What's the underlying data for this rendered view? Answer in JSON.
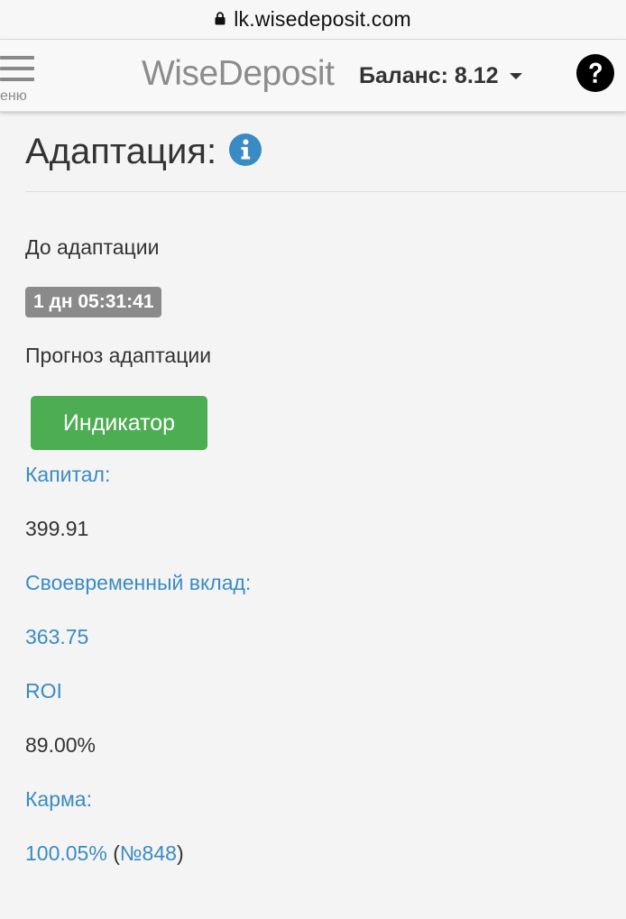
{
  "browser": {
    "url": "lk.wisedeposit.com"
  },
  "header": {
    "menu_label": "еню",
    "brand": "WiseDeposit",
    "balance_label": "Баланс: 8.12"
  },
  "main": {
    "title": "Адаптация:",
    "before_label": "До адаптации",
    "timer": "1 дн 05:31:41",
    "forecast_label": "Прогноз адаптации",
    "indicator_button": "Индикатор",
    "capital_label": "Капитал:",
    "capital_value": "399.91",
    "deposit_label": "Своевременный вклад:",
    "deposit_value": "363.75",
    "roi_label": "ROI",
    "roi_value": "89.00%",
    "karma_label": "Карма:",
    "karma_value": "100.05%",
    "karma_paren_open": " (",
    "karma_rank": "№848",
    "karma_paren_close": ")"
  },
  "colors": {
    "link": "#3a8bc4",
    "indicator_button": "#4cad52",
    "timer_badge": "#8a8a8a",
    "info_icon": "#3a8bc4"
  },
  "icons": {
    "lock": "lock-icon",
    "menu": "hamburger-menu-icon",
    "caret": "caret-down-icon",
    "help": "question-circle-icon",
    "info": "info-circle-icon"
  }
}
